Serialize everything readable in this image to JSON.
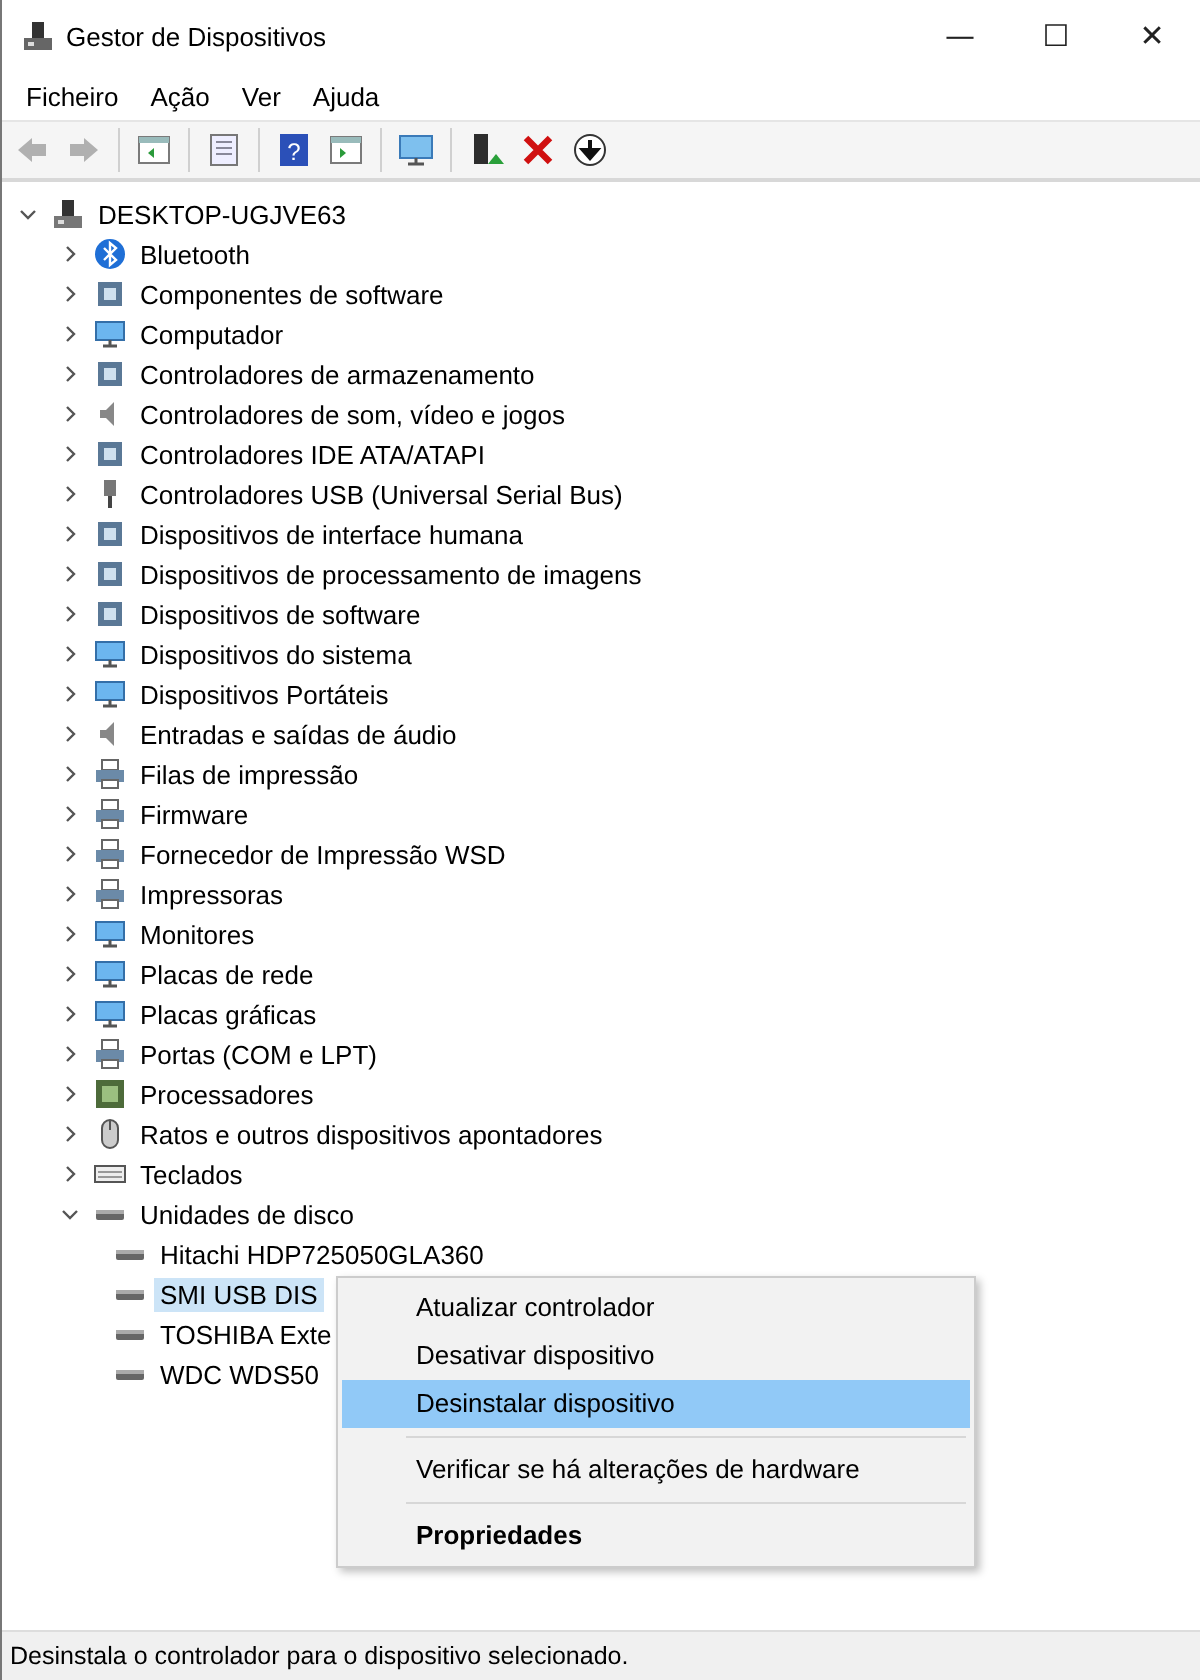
{
  "window": {
    "title": "Gestor de Dispositivos",
    "controls": [
      "—",
      "☐",
      "✕"
    ]
  },
  "menu": [
    "Ficheiro",
    "Ação",
    "Ver",
    "Ajuda"
  ],
  "toolbar": [
    {
      "kind": "back",
      "disabled": true
    },
    {
      "kind": "forward",
      "disabled": true
    },
    {
      "kind": "sep"
    },
    {
      "kind": "panel"
    },
    {
      "kind": "sep"
    },
    {
      "kind": "properties"
    },
    {
      "kind": "sep"
    },
    {
      "kind": "help",
      "glyph": "?"
    },
    {
      "kind": "panel2"
    },
    {
      "kind": "sep"
    },
    {
      "kind": "monitor"
    },
    {
      "kind": "sep"
    },
    {
      "kind": "update"
    },
    {
      "kind": "remove"
    },
    {
      "kind": "download"
    }
  ],
  "tree": [
    {
      "label": "DESKTOP-UGJVE63",
      "kind": "computer",
      "expanded": true,
      "selected": false,
      "children": [
        {
          "label": "Bluetooth",
          "kind": "bluetooth",
          "expanded": false,
          "selected": false
        },
        {
          "label": "Componentes de software",
          "kind": "device",
          "expanded": false,
          "selected": false
        },
        {
          "label": "Computador",
          "kind": "monitor",
          "expanded": false,
          "selected": false
        },
        {
          "label": "Controladores de armazenamento",
          "kind": "device",
          "expanded": false,
          "selected": false
        },
        {
          "label": "Controladores de som, vídeo e jogos",
          "kind": "speaker",
          "expanded": false,
          "selected": false
        },
        {
          "label": "Controladores IDE ATA/ATAPI",
          "kind": "device",
          "expanded": false,
          "selected": false
        },
        {
          "label": "Controladores USB (Universal Serial Bus)",
          "kind": "usb",
          "expanded": false,
          "selected": false
        },
        {
          "label": "Dispositivos de interface humana",
          "kind": "device",
          "expanded": false,
          "selected": false
        },
        {
          "label": "Dispositivos de processamento de imagens",
          "kind": "device",
          "expanded": false,
          "selected": false
        },
        {
          "label": "Dispositivos de software",
          "kind": "device",
          "expanded": false,
          "selected": false
        },
        {
          "label": "Dispositivos do sistema",
          "kind": "monitor",
          "expanded": false,
          "selected": false
        },
        {
          "label": "Dispositivos Portáteis",
          "kind": "monitor",
          "expanded": false,
          "selected": false
        },
        {
          "label": "Entradas e saídas de áudio",
          "kind": "speaker",
          "expanded": false,
          "selected": false
        },
        {
          "label": "Filas de impressão",
          "kind": "printer",
          "expanded": false,
          "selected": false
        },
        {
          "label": "Firmware",
          "kind": "printer",
          "expanded": false,
          "selected": false
        },
        {
          "label": "Fornecedor de Impressão WSD",
          "kind": "printer",
          "expanded": false,
          "selected": false
        },
        {
          "label": "Impressoras",
          "kind": "printer",
          "expanded": false,
          "selected": false
        },
        {
          "label": "Monitores",
          "kind": "monitor",
          "expanded": false,
          "selected": false
        },
        {
          "label": "Placas de rede",
          "kind": "monitor",
          "expanded": false,
          "selected": false
        },
        {
          "label": "Placas gráficas",
          "kind": "monitor",
          "expanded": false,
          "selected": false
        },
        {
          "label": "Portas (COM e LPT)",
          "kind": "printer",
          "expanded": false,
          "selected": false
        },
        {
          "label": "Processadores",
          "kind": "chip",
          "expanded": false,
          "selected": false
        },
        {
          "label": "Ratos e outros dispositivos apontadores",
          "kind": "mouse",
          "expanded": false,
          "selected": false
        },
        {
          "label": "Teclados",
          "kind": "keyboard",
          "expanded": false,
          "selected": false
        },
        {
          "label": "Unidades de disco",
          "kind": "drive",
          "expanded": true,
          "selected": false,
          "children": [
            {
              "label": "Hitachi HDP725050GLA360",
              "kind": "drive",
              "selected": false
            },
            {
              "label": "SMI USB DIS",
              "kind": "drive",
              "selected": true
            },
            {
              "label": "TOSHIBA Exte",
              "kind": "drive",
              "selected": false
            },
            {
              "label": "WDC WDS50",
              "kind": "drive",
              "selected": false
            }
          ]
        }
      ]
    }
  ],
  "context_menu": [
    {
      "kind": "item",
      "label": "Atualizar controlador",
      "selected": false,
      "default": false
    },
    {
      "kind": "item",
      "label": "Desativar dispositivo",
      "selected": false,
      "default": false
    },
    {
      "kind": "item",
      "label": "Desinstalar dispositivo",
      "selected": true,
      "default": false
    },
    {
      "kind": "separator"
    },
    {
      "kind": "item",
      "label": "Verificar se há alterações de hardware",
      "selected": false,
      "default": false
    },
    {
      "kind": "separator"
    },
    {
      "kind": "item",
      "label": "Propriedades",
      "selected": false,
      "default": true
    }
  ],
  "status_bar": "Desinstala o controlador para o dispositivo selecionado."
}
